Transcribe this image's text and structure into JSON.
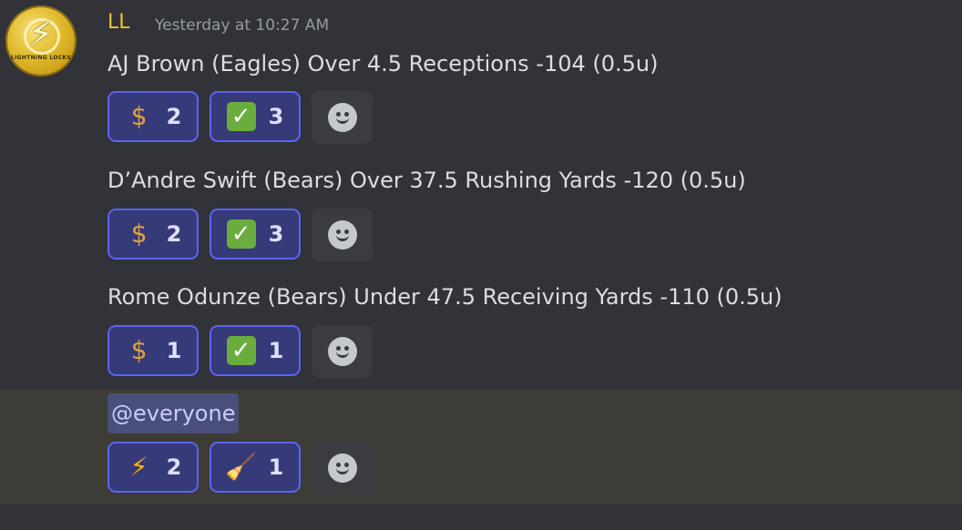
{
  "user": {
    "name": "LL",
    "avatar_text": "LIGHTNING LOCKS",
    "timestamp": "Yesterday at 10:27 AM"
  },
  "messages": [
    {
      "text": "AJ Brown (Eagles) Over 4.5 Receptions -104 (0.5u)",
      "reactions": [
        {
          "emoji": "money-bag",
          "glyph": "$",
          "count": "2"
        },
        {
          "emoji": "check-mark",
          "glyph": "✓",
          "count": "3"
        }
      ]
    },
    {
      "text": "D’Andre Swift (Bears) Over 37.5 Rushing Yards -120 (0.5u)",
      "reactions": [
        {
          "emoji": "money-bag",
          "glyph": "$",
          "count": "2"
        },
        {
          "emoji": "check-mark",
          "glyph": "✓",
          "count": "3"
        }
      ]
    },
    {
      "text": "Rome Odunze (Bears) Under 47.5 Receiving Yards -110 (0.5u)",
      "reactions": [
        {
          "emoji": "money-bag",
          "glyph": "$",
          "count": "1"
        },
        {
          "emoji": "check-mark",
          "glyph": "✓",
          "count": "1"
        }
      ]
    },
    {
      "text": "@everyone",
      "reactions": [
        {
          "emoji": "high-voltage",
          "glyph": "⚡",
          "count": "2"
        },
        {
          "emoji": "broom",
          "glyph": "🧹",
          "count": "1"
        }
      ]
    }
  ],
  "colors": {
    "background": "#313338",
    "username": "#f0c232",
    "reaction_border": "#5865f2",
    "mention_highlight": "#3e3c36"
  }
}
